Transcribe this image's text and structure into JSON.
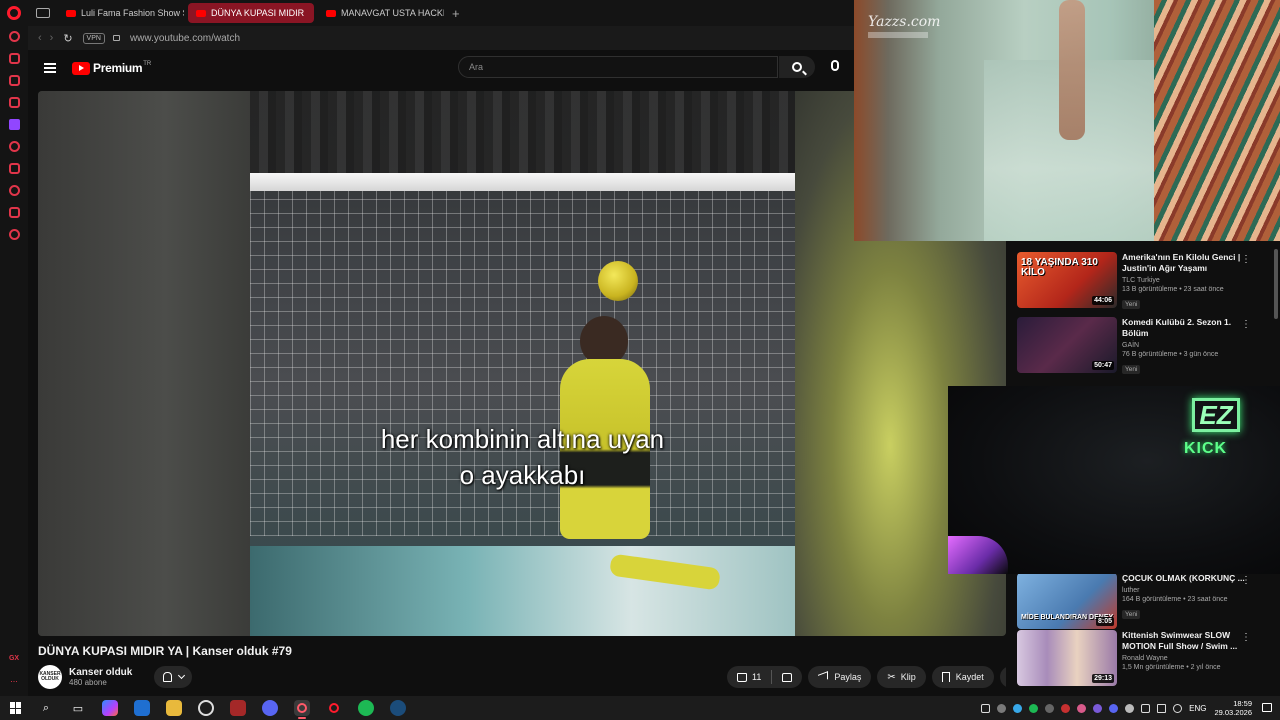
{
  "browser": {
    "tabs": [
      {
        "label": "Luli Fama Fashion Show S",
        "active": false
      },
      {
        "label": "DÜNYA KUPASI MIDIR",
        "active": true
      },
      {
        "label": "MANAVGAT USTA HACKE",
        "active": false
      }
    ],
    "new_tab_label": "+",
    "vpn_label": "VPN",
    "url": "www.youtube.com/watch",
    "sidebar_gx_label": "GX",
    "sidebar_more_label": "..."
  },
  "youtube": {
    "brand": "Premium",
    "region": "TR",
    "search_placeholder": "Ara",
    "video": {
      "caption_line1": "her kombinin altına uyan",
      "caption_line2": "o ayakkabı"
    },
    "title": "DÜNYA KUPASI MIDIR YA | Kanser olduk #79",
    "channel": {
      "name": "Kanser olduk",
      "subscribers": "480 abone",
      "avatar_text": "KANSER OLDUK"
    },
    "actions": {
      "like_count": "11",
      "share": "Paylaş",
      "clip": "Klip",
      "save": "Kaydet",
      "more": "···"
    },
    "recommendations": [
      {
        "title": "Amerika'nın En Kilolu Genci | Justin'in Ağır Yaşamı",
        "channel": "TLC Turkiye",
        "meta": "13 B görüntüleme • 23 saat önce",
        "badge": "Yeni",
        "duration": "44:06",
        "thumb_text": "18 YAŞINDA 310 KİLO",
        "thumb_color": "#d9452a"
      },
      {
        "title": "Komedi Kulübü 2. Sezon 1. Bölüm",
        "channel": "GAİN",
        "meta": "76 B görüntüleme • 3 gün önce",
        "badge": "Yeni",
        "duration": "50:47",
        "thumb_text": "",
        "thumb_color": "#3a2a4a"
      },
      {
        "title": "ÇOCUK OLMAK (KORKUNÇ ...",
        "channel": "luther",
        "meta": "164 B görüntüleme • 23 saat önce",
        "badge": "Yeni",
        "duration": "8:05",
        "thumb_text": "MİDE BULANDIRAN DENEY",
        "thumb_color": "#6aa0d8"
      },
      {
        "title": "Kittenish Swimwear SLOW MOTION Full Show / Swim ...",
        "channel": "Ronald Wayne",
        "meta": "1,5 Mn görüntüleme • 2 yıl önce",
        "badge": "",
        "duration": "29:13",
        "thumb_text": "",
        "thumb_color": "#b6a0c8"
      }
    ]
  },
  "overlays": {
    "fashion_watermark": "Yazzs.com",
    "stream_logo": "EZ",
    "stream_platform": "KICK"
  },
  "taskbar": {
    "language": "ENG",
    "time": "18:59",
    "date": "29.03.2026"
  }
}
